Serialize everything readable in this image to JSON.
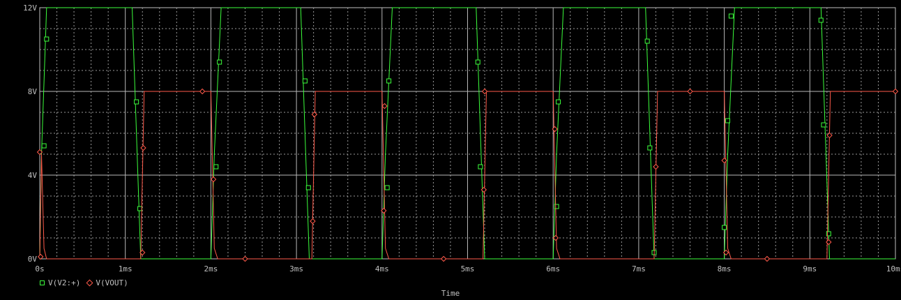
{
  "chart_data": {
    "type": "line",
    "xlabel": "Time",
    "ylabel": "",
    "xlim": [
      0,
      10
    ],
    "ylim": [
      0,
      12
    ],
    "x_ticks": [
      "0s",
      "1ms",
      "2ms",
      "3ms",
      "4ms",
      "5ms",
      "6ms",
      "7ms",
      "8ms",
      "9ms",
      "10ms"
    ],
    "y_ticks": [
      "0V",
      "4V",
      "8V",
      "12V"
    ],
    "grid": true,
    "legend_position": "bottom-left",
    "series": [
      {
        "name": "V(V2:+)",
        "color": "#3cff3c",
        "marker": "square",
        "points": [
          [
            0.0,
            0
          ],
          [
            0.02,
            5
          ],
          [
            0.08,
            12
          ],
          [
            1.08,
            12
          ],
          [
            1.18,
            0
          ],
          [
            2.0,
            0
          ],
          [
            2.04,
            5
          ],
          [
            2.12,
            12
          ],
          [
            3.05,
            12
          ],
          [
            3.15,
            0
          ],
          [
            4.0,
            0
          ],
          [
            4.04,
            5
          ],
          [
            4.12,
            12
          ],
          [
            5.1,
            12
          ],
          [
            5.2,
            0
          ],
          [
            6.0,
            0
          ],
          [
            6.04,
            5
          ],
          [
            6.12,
            12
          ],
          [
            7.08,
            12
          ],
          [
            7.18,
            0
          ],
          [
            8.0,
            0
          ],
          [
            8.04,
            5
          ],
          [
            8.12,
            12
          ],
          [
            9.13,
            12
          ],
          [
            9.23,
            0
          ],
          [
            10.0,
            0
          ]
        ],
        "markers": [
          [
            0.05,
            5.4
          ],
          [
            0.08,
            10.5
          ],
          [
            1.13,
            7.5
          ],
          [
            1.17,
            2.4
          ],
          [
            2.06,
            4.4
          ],
          [
            2.1,
            9.4
          ],
          [
            3.1,
            8.5
          ],
          [
            3.14,
            3.4
          ],
          [
            4.06,
            3.4
          ],
          [
            4.08,
            8.5
          ],
          [
            5.12,
            9.4
          ],
          [
            5.15,
            4.4
          ],
          [
            6.04,
            2.5
          ],
          [
            6.06,
            7.5
          ],
          [
            7.1,
            10.4
          ],
          [
            7.13,
            5.3
          ],
          [
            7.18,
            0.3
          ],
          [
            8.0,
            1.5
          ],
          [
            8.04,
            6.6
          ],
          [
            8.08,
            11.6
          ],
          [
            9.13,
            11.4
          ],
          [
            9.16,
            6.4
          ],
          [
            9.22,
            1.2
          ]
        ]
      },
      {
        "name": "V(VOUT)",
        "color": "#ff5a4a",
        "marker": "diamond",
        "points": [
          [
            0.0,
            0
          ],
          [
            0.02,
            5
          ],
          [
            0.05,
            0.5
          ],
          [
            0.08,
            0
          ],
          [
            1.18,
            0
          ],
          [
            1.22,
            8
          ],
          [
            2.0,
            8
          ],
          [
            2.04,
            0.5
          ],
          [
            2.08,
            0
          ],
          [
            3.18,
            0
          ],
          [
            3.22,
            8
          ],
          [
            4.0,
            8
          ],
          [
            4.04,
            0.5
          ],
          [
            4.08,
            0
          ],
          [
            5.18,
            0
          ],
          [
            5.22,
            8
          ],
          [
            6.0,
            8
          ],
          [
            6.04,
            0.5
          ],
          [
            6.08,
            0
          ],
          [
            7.18,
            0
          ],
          [
            7.22,
            8
          ],
          [
            8.0,
            8
          ],
          [
            8.04,
            0.5
          ],
          [
            8.08,
            0
          ],
          [
            9.2,
            0
          ],
          [
            9.24,
            8
          ],
          [
            10.0,
            8
          ]
        ],
        "markers": [
          [
            0.0,
            5.1
          ],
          [
            0.01,
            0.1
          ],
          [
            1.2,
            0.3
          ],
          [
            1.21,
            5.3
          ],
          [
            1.9,
            8
          ],
          [
            2.03,
            3.8
          ],
          [
            2.4,
            0
          ],
          [
            3.19,
            1.8
          ],
          [
            3.21,
            6.9
          ],
          [
            4.02,
            2.3
          ],
          [
            4.03,
            7.3
          ],
          [
            4.72,
            0
          ],
          [
            5.19,
            3.3
          ],
          [
            5.2,
            8
          ],
          [
            6.02,
            6.2
          ],
          [
            6.03,
            1.0
          ],
          [
            7.2,
            4.4
          ],
          [
            7.6,
            8
          ],
          [
            8.0,
            4.7
          ],
          [
            8.02,
            0.3
          ],
          [
            8.5,
            0
          ],
          [
            9.22,
            0.8
          ],
          [
            9.23,
            5.9
          ],
          [
            10.0,
            8
          ]
        ]
      }
    ]
  }
}
